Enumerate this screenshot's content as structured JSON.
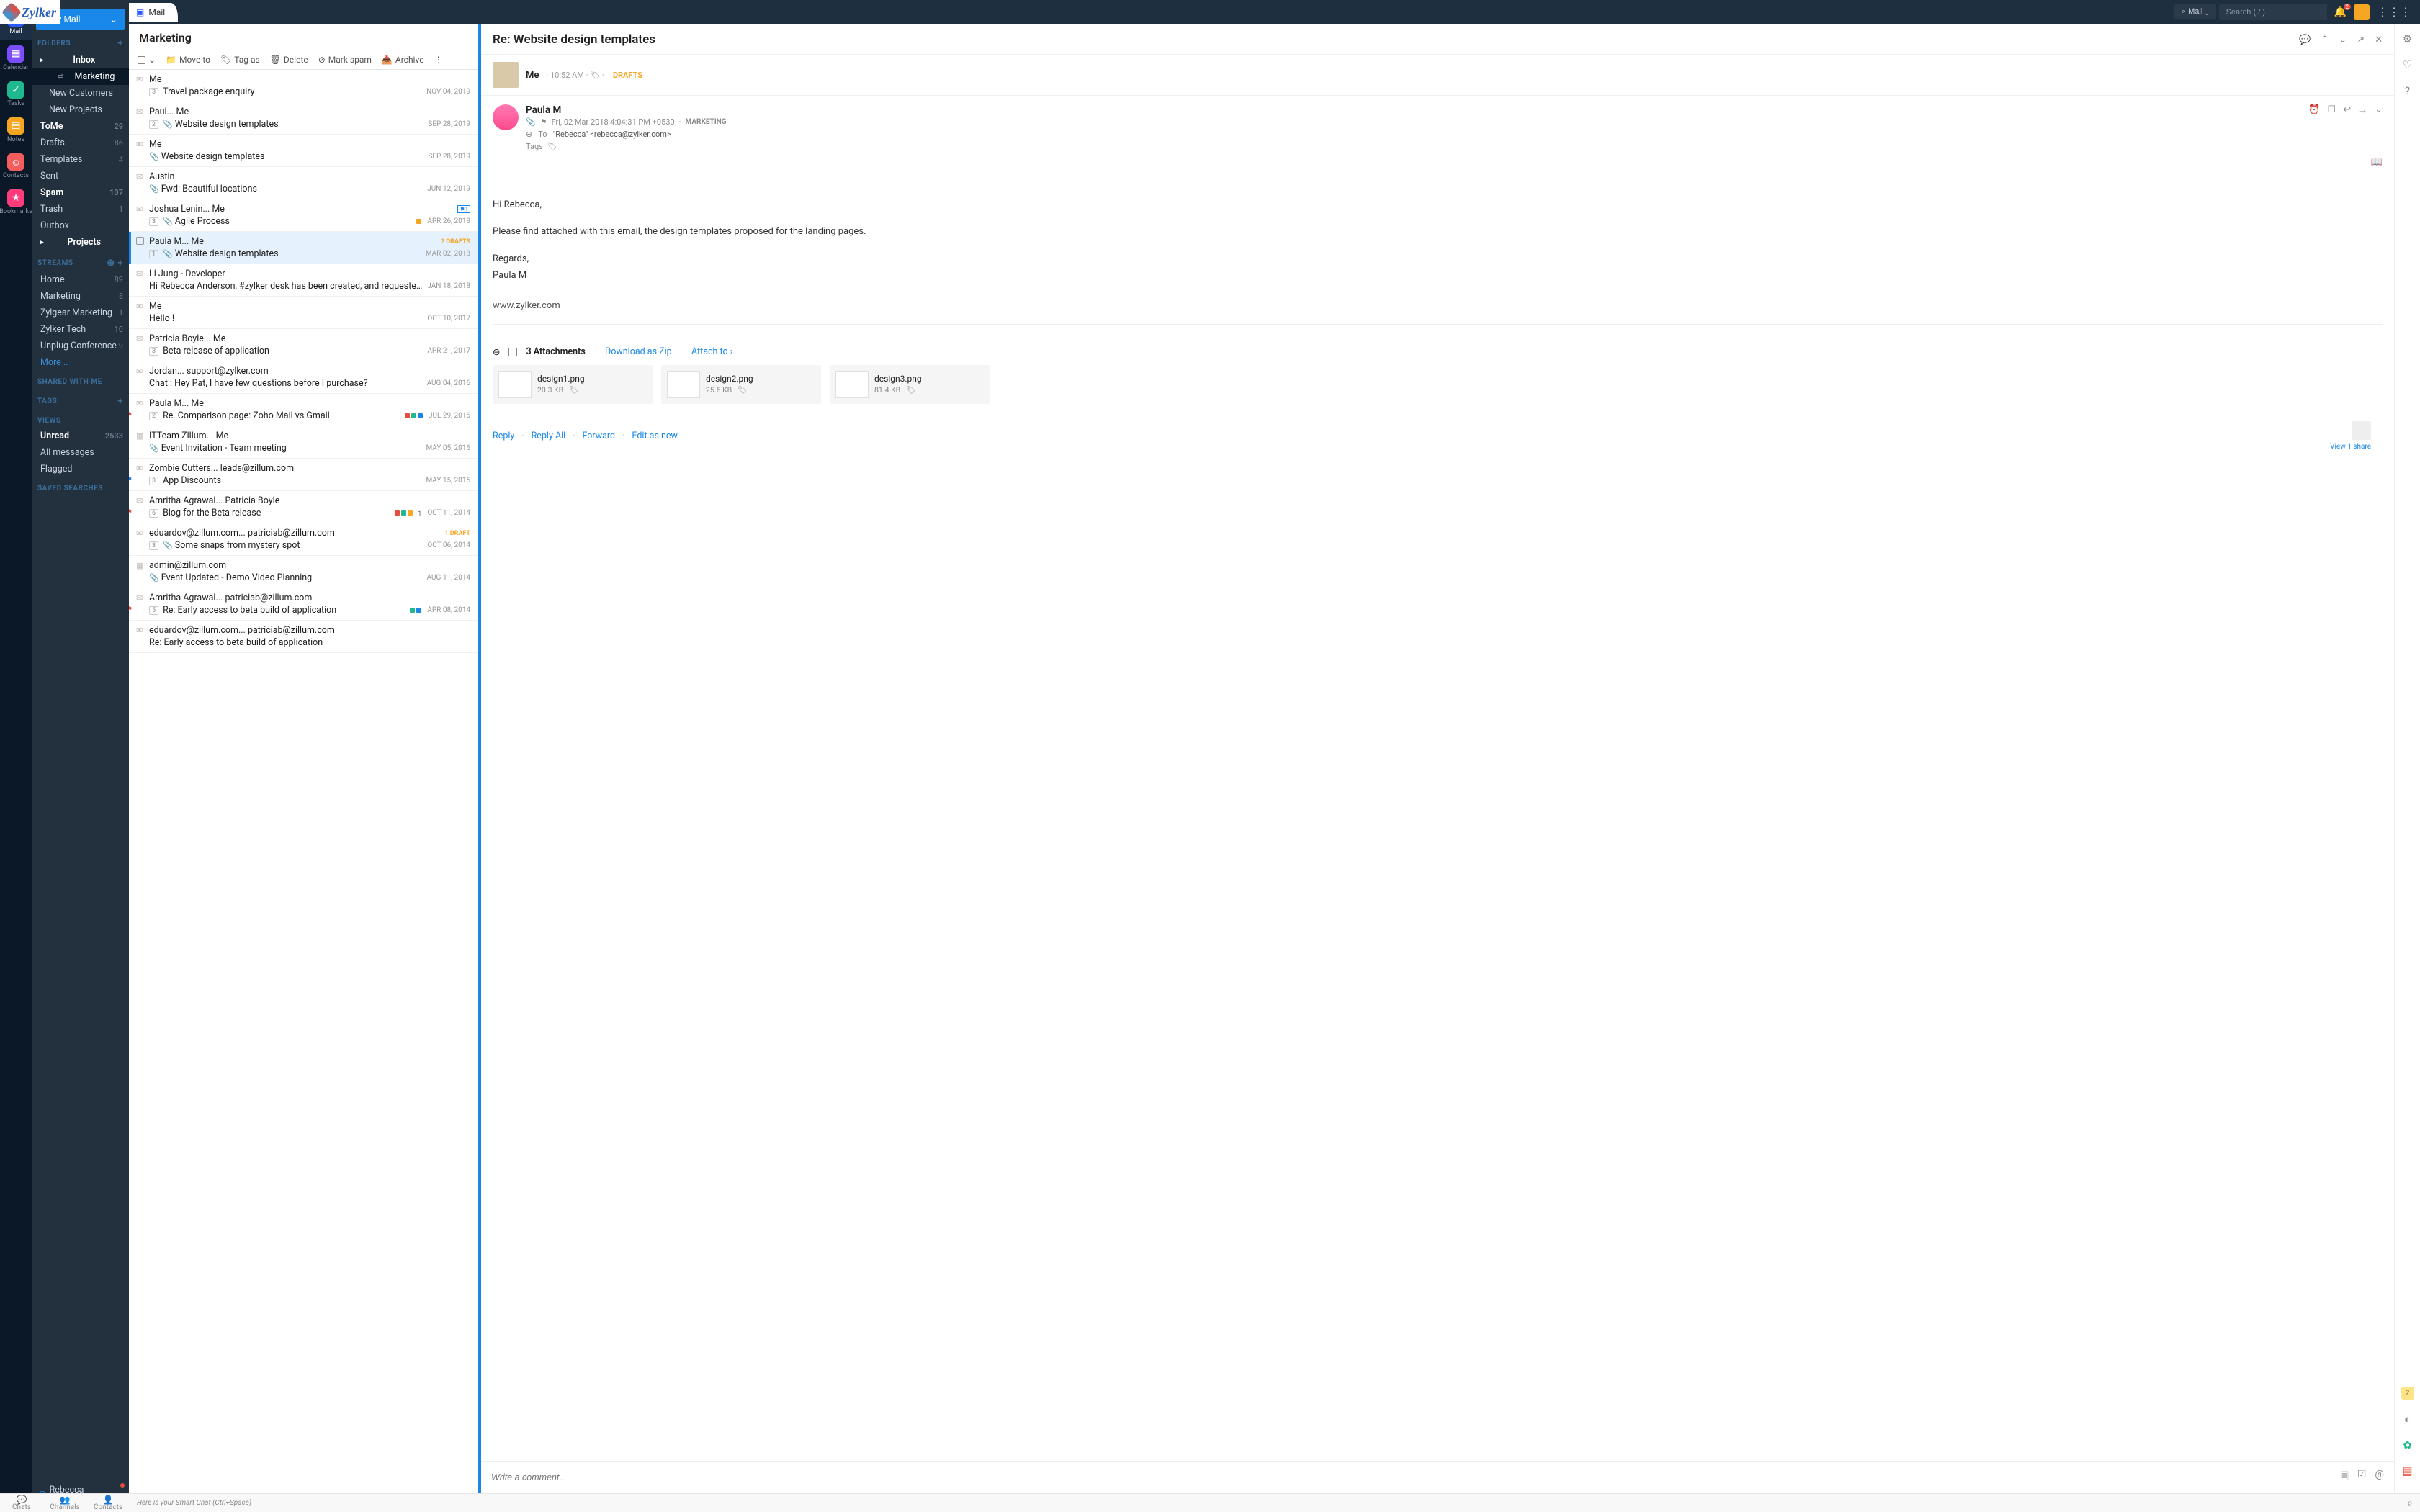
{
  "brand": "Zylker",
  "rail": {
    "items": [
      {
        "label": "Mail",
        "icon": "✉"
      },
      {
        "label": "Calendar",
        "icon": "▦"
      },
      {
        "label": "Tasks",
        "icon": "✓"
      },
      {
        "label": "Notes",
        "icon": "▤"
      },
      {
        "label": "Contacts",
        "icon": "☺"
      },
      {
        "label": "Bookmarks",
        "icon": "★"
      }
    ]
  },
  "sidebar": {
    "new_mail": "New Mail",
    "sections": {
      "folders": "FOLDERS",
      "streams": "STREAMS",
      "shared": "SHARED WITH ME",
      "tags": "TAGS",
      "views": "VIEWS",
      "saved": "SAVED SEARCHES"
    },
    "folders": [
      {
        "label": "Inbox",
        "count": "",
        "bold": true,
        "expandable": true
      },
      {
        "label": "Marketing",
        "count": "",
        "child": true,
        "active": true,
        "shared": true
      },
      {
        "label": "New Customers",
        "count": "",
        "child": true
      },
      {
        "label": "New Projects",
        "count": "",
        "child": true
      },
      {
        "label": "ToMe",
        "count": "29",
        "bold": true
      },
      {
        "label": "Drafts",
        "count": "86"
      },
      {
        "label": "Templates",
        "count": "4"
      },
      {
        "label": "Sent",
        "count": ""
      },
      {
        "label": "Spam",
        "count": "107",
        "bold": true
      },
      {
        "label": "Trash",
        "count": "1"
      },
      {
        "label": "Outbox",
        "count": ""
      },
      {
        "label": "Projects",
        "count": "",
        "bold": true,
        "expandable": true
      }
    ],
    "streams": [
      {
        "label": "Home",
        "count": "89"
      },
      {
        "label": "Marketing",
        "count": "8"
      },
      {
        "label": "Zylgear Marketing",
        "count": "1"
      },
      {
        "label": "Zylker Tech",
        "count": "10"
      },
      {
        "label": "Unplug Conference",
        "count": "9"
      },
      {
        "label": "More ..",
        "more": true
      }
    ],
    "views": [
      {
        "label": "Unread",
        "count": "2533",
        "bold": true
      },
      {
        "label": "All messages"
      },
      {
        "label": "Flagged"
      }
    ],
    "user": "Rebecca Anderson"
  },
  "topbar": {
    "tab": "Mail",
    "scope": "Mail",
    "search_placeholder": "Search ( / )",
    "notif_count": "2"
  },
  "list": {
    "title": "Marketing",
    "toolbar": {
      "move": "Move to",
      "tag": "Tag as",
      "delete": "Delete",
      "spam": "Mark spam",
      "archive": "Archive"
    },
    "items": [
      {
        "sender": "Me",
        "subject": "Travel package enquiry",
        "date": "NOV 04, 2019",
        "count": "3"
      },
      {
        "sender": "Paul... Me",
        "subject": "Website design templates",
        "date": "SEP 28, 2019",
        "count": "2",
        "attach": true
      },
      {
        "sender": "Me",
        "subject": "Website design templates",
        "date": "SEP 28, 2019",
        "attach": true
      },
      {
        "sender": "Austin",
        "subject": "Fwd: Beautiful locations",
        "date": "JUN 12, 2019",
        "attach": true
      },
      {
        "sender": "Joshua Lenin... Me",
        "subject": "Agile Process",
        "date": "APR 26, 2018",
        "count": "3",
        "attach": true,
        "dots": [
          "#f5a623"
        ],
        "flagnum": "1"
      },
      {
        "sender": "Paula M... Me",
        "subject": "Website design templates",
        "date": "MAR 02, 2018",
        "count": "1",
        "attach": true,
        "drafts": "2 DRAFTS",
        "selected": true
      },
      {
        "sender": "Li Jung - Developer",
        "subject": "Hi Rebecca Anderson, #zylker desk has been created, and requested for yo...",
        "date": "JAN 18, 2018"
      },
      {
        "sender": "Me",
        "subject": "Hello !",
        "date": "OCT 10, 2017"
      },
      {
        "sender": "Patricia Boyle... Me",
        "subject": "Beta release of application",
        "date": "APR 21, 2017",
        "count": "3"
      },
      {
        "sender": "Jordan... support@zylker.com",
        "subject": "Chat : Hey Pat, I have few questions before I purchase?",
        "date": "AUG 04, 2016"
      },
      {
        "sender": "Paula M... Me",
        "subject": "Re. Comparison page: Zoho Mail vs Gmail",
        "date": "JUL 29, 2016",
        "count": "2",
        "flag": "red",
        "dots": [
          "#e74c3c",
          "#1fb88f",
          "#1a88e8"
        ]
      },
      {
        "sender": "ITTeam Zillum... Me",
        "subject": "Event Invitation - Team meeting",
        "date": "MAY 05, 2016",
        "cal": true,
        "attach": true
      },
      {
        "sender": "Zombie Cutters... leads@zillum.com",
        "subject": "App Discounts",
        "date": "MAY 15, 2015",
        "count": "3",
        "flag": "blue"
      },
      {
        "sender": "Amritha Agrawal... Patricia Boyle",
        "subject": "Blog for the Beta release",
        "date": "OCT 11, 2014",
        "count": "6",
        "flag": "red",
        "dots": [
          "#e74c3c",
          "#1fb88f",
          "#f5a623"
        ],
        "extra": "+1"
      },
      {
        "sender": "eduardov@zillum.com... patriciab@zillum.com",
        "subject": "Some snaps from mystery spot",
        "date": "OCT 06, 2014",
        "count": "3",
        "attach": true,
        "drafts": "1 DRAFT"
      },
      {
        "sender": "admin@zillum.com",
        "subject": "Event Updated - Demo Video Planning",
        "date": "AUG 11, 2014",
        "cal": true,
        "attach": true
      },
      {
        "sender": "Amritha Agrawal... patriciab@zillum.com",
        "subject": "Re: Early access to beta build of application",
        "date": "APR 08, 2014",
        "count": "5",
        "flag": "red",
        "dots": [
          "#1fb88f",
          "#1a88e8"
        ]
      },
      {
        "sender": "eduardov@zillum.com... patriciab@zillum.com",
        "subject": "Re: Early access to beta build of application",
        "date": ""
      }
    ]
  },
  "reader": {
    "subject": "Re: Website design templates",
    "draft": {
      "who": "Me",
      "time": "10:52 AM",
      "label": "DRAFTS"
    },
    "message": {
      "from": "Paula M",
      "date": "Fri, 02 Mar 2018 4:04:31 PM +0530",
      "stream": "MARKETING",
      "to_label": "To",
      "to": "\"Rebecca\" <rebecca@zylker.com>",
      "tags_label": "Tags",
      "body": {
        "greeting": "Hi Rebecca,",
        "line": "Please find attached with this email, the design templates proposed for the landing pages.",
        "regards": "Regards,",
        "sig_name": "Paula M",
        "url": "www.zylker.com"
      }
    },
    "attachments": {
      "count_label": "3 Attachments",
      "download": "Download as Zip",
      "attach_to": "Attach to",
      "files": [
        {
          "name": "design1.png",
          "size": "20.3 KB"
        },
        {
          "name": "design2.png",
          "size": "25.6 KB"
        },
        {
          "name": "design3.png",
          "size": "81.4 KB"
        }
      ]
    },
    "actions": {
      "reply": "Reply",
      "reply_all": "Reply All",
      "forward": "Forward",
      "edit": "Edit as new"
    },
    "share": "View 1 share",
    "comment_placeholder": "Write a comment..."
  },
  "bottom": {
    "chats": "Chats",
    "channels": "Channels",
    "contacts": "Contacts",
    "hint": "Here is your Smart Chat (Ctrl+Space)"
  },
  "right_badge": "2"
}
